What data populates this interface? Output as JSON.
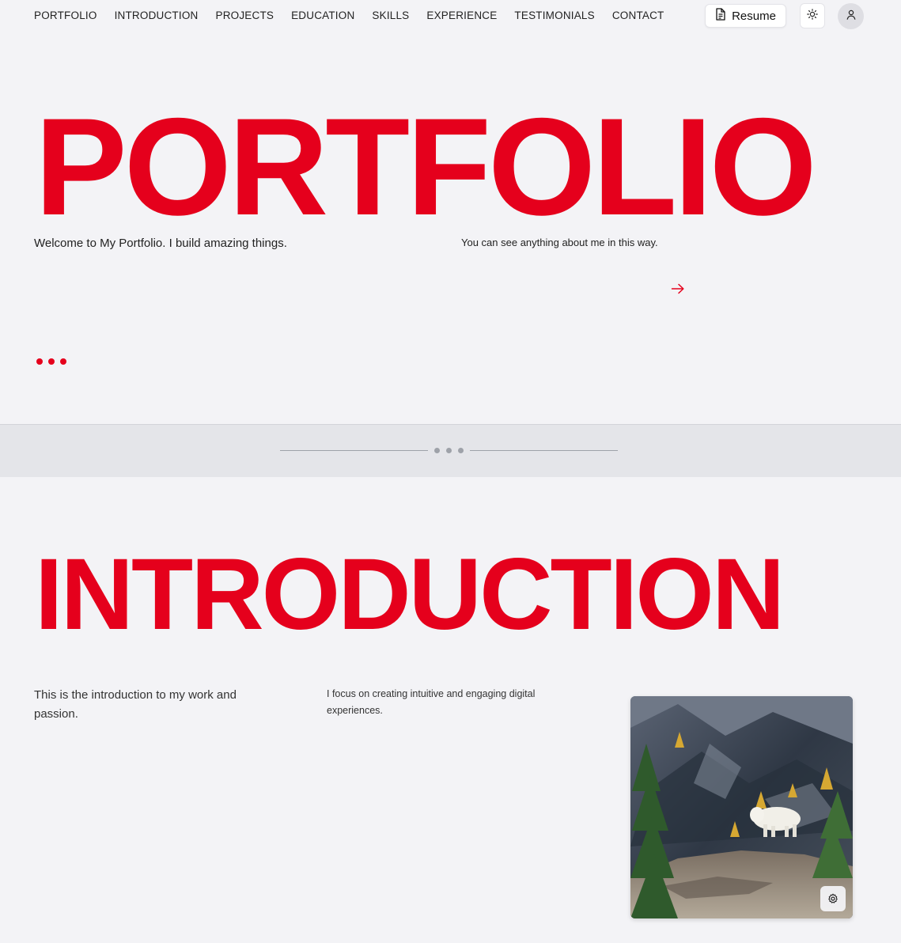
{
  "nav": {
    "items": [
      {
        "label": "PORTFOLIO"
      },
      {
        "label": "INTRODUCTION"
      },
      {
        "label": "PROJECTS"
      },
      {
        "label": "EDUCATION"
      },
      {
        "label": "SKILLS"
      },
      {
        "label": "EXPERIENCE"
      },
      {
        "label": "TESTIMONIALS"
      },
      {
        "label": "CONTACT"
      }
    ],
    "resume_label": "Resume",
    "theme_icon": "sun-icon",
    "avatar_icon": "user-icon"
  },
  "hero": {
    "title": "PORTFOLIO",
    "subtitle_left": "Welcome to My Portfolio. I build amazing things.",
    "subtitle_right": "You can see anything about me in this way.",
    "arrow_icon": "arrow-right-icon"
  },
  "intro": {
    "title": "INTRODUCTION",
    "text_left": "This is the introduction to my work and passion.",
    "text_mid": "I focus on creating intuitive and engaging digital experiences.",
    "photo_settings_icon": "gear-icon"
  },
  "colors": {
    "accent": "#e5001c",
    "background": "#f3f3f6",
    "divider": "#e4e5e9"
  }
}
